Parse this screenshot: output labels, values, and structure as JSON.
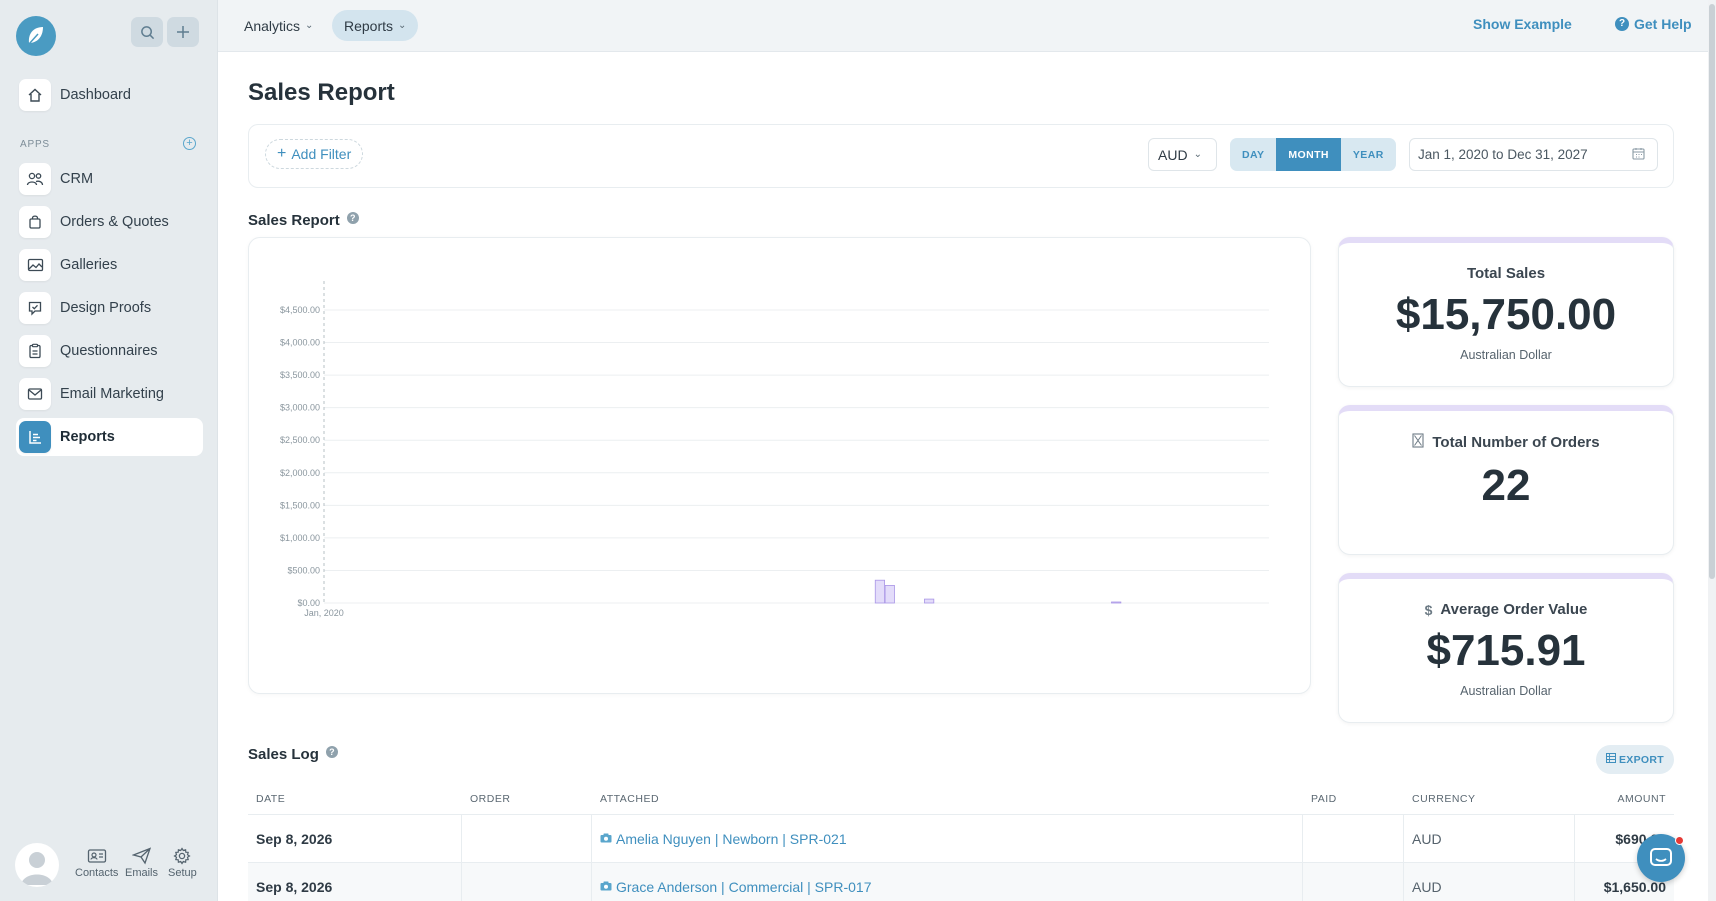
{
  "sidebar": {
    "apps_label": "APPS",
    "items": [
      {
        "label": "Dashboard",
        "icon": "home-icon"
      },
      {
        "label": "CRM",
        "icon": "users-icon"
      },
      {
        "label": "Orders & Quotes",
        "icon": "shopping-bag-icon"
      },
      {
        "label": "Galleries",
        "icon": "gallery-icon"
      },
      {
        "label": "Design Proofs",
        "icon": "proof-icon"
      },
      {
        "label": "Questionnaires",
        "icon": "clipboard-icon"
      },
      {
        "label": "Email Marketing",
        "icon": "mail-icon"
      },
      {
        "label": "Reports",
        "icon": "report-icon",
        "active": true
      }
    ],
    "footer": {
      "contacts": "Contacts",
      "emails": "Emails",
      "setup": "Setup"
    }
  },
  "topbar": {
    "analytics": "Analytics",
    "reports": "Reports",
    "show_example": "Show Example",
    "get_help": "Get Help"
  },
  "page": {
    "title": "Sales Report",
    "add_filter": "Add Filter",
    "currency": "AUD",
    "periods": [
      "DAY",
      "MONTH",
      "YEAR"
    ],
    "active_period": "MONTH",
    "date_range": "Jan 1, 2020 to Dec 31, 2027"
  },
  "chart_section": {
    "title": "Sales Report",
    "help": "?"
  },
  "chart_data": {
    "type": "bar",
    "title": "",
    "xlabel": "",
    "ylabel": "",
    "ylim": [
      0,
      4500
    ],
    "y_ticks": [
      "$0.00",
      "$500.00",
      "$1,000.00",
      "$1,500.00",
      "$2,000.00",
      "$2,500.00",
      "$3,000.00",
      "$3,500.00",
      "$4,000.00",
      "$4,500.00"
    ],
    "x_tick_labels": [
      "Jan, 2020"
    ],
    "months": 96,
    "bars": [
      {
        "month_index": 56,
        "value": 350
      },
      {
        "month_index": 57,
        "value": 270
      },
      {
        "month_index": 61,
        "value": 60
      },
      {
        "month_index": 80,
        "value": 10
      }
    ],
    "grid": true,
    "color": "#e3dcfa",
    "stroke": "#a995e6"
  },
  "stats": {
    "total_sales": {
      "label": "Total Sales",
      "value": "$15,750.00",
      "sub": "Australian Dollar"
    },
    "total_orders": {
      "label": "Total Number of Orders",
      "value": "22"
    },
    "avg_order": {
      "label": "Average Order Value",
      "value": "$715.91",
      "sub": "Australian Dollar"
    }
  },
  "sales_log": {
    "title": "Sales Log",
    "export": "EXPORT",
    "columns": [
      "DATE",
      "ORDER",
      "ATTACHED",
      "PAID",
      "CURRENCY",
      "AMOUNT"
    ],
    "rows": [
      {
        "date": "Sep 8, 2026",
        "order": "",
        "attached": "Amelia Nguyen | Newborn | SPR-021",
        "paid": "",
        "currency": "AUD",
        "amount": "$690.00"
      },
      {
        "date": "Sep 8, 2026",
        "order": "",
        "attached": "Grace Anderson | Commercial | SPR-017",
        "paid": "",
        "currency": "AUD",
        "amount": "$1,650.00"
      }
    ]
  }
}
